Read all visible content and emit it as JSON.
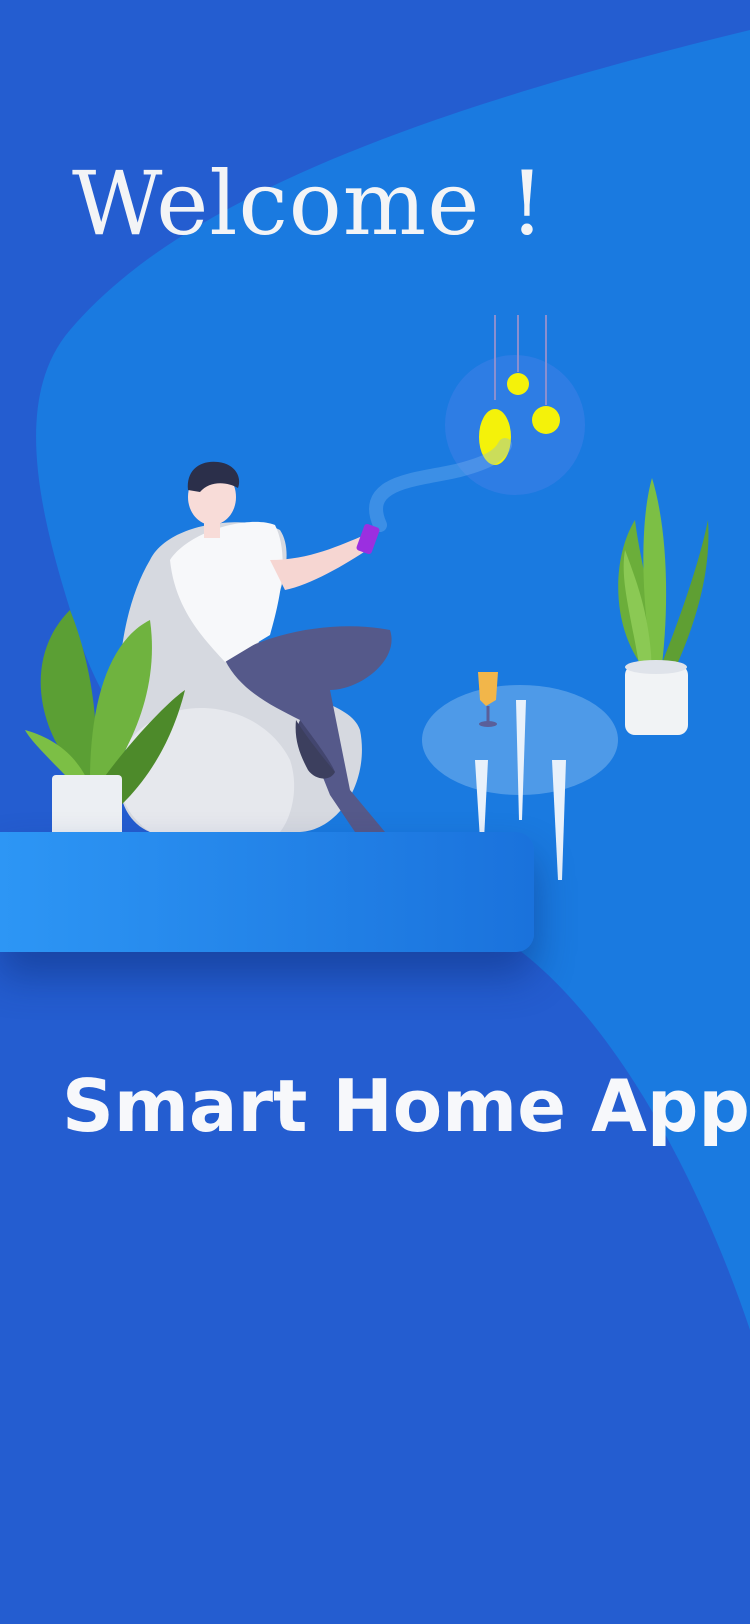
{
  "screen": {
    "welcome_text": "Welcome !",
    "app_title": "Smart Home App"
  },
  "colors": {
    "background": "#245dd0",
    "curve": "#1a7ae0",
    "platform": "#2d96f5",
    "text": "#f3f4f6"
  },
  "illustration": {
    "subject": "man-sitting-in-chair-with-phone",
    "elements": [
      "pendant-lamps",
      "plant-left",
      "plant-right",
      "glass-table",
      "wine-glass"
    ]
  }
}
